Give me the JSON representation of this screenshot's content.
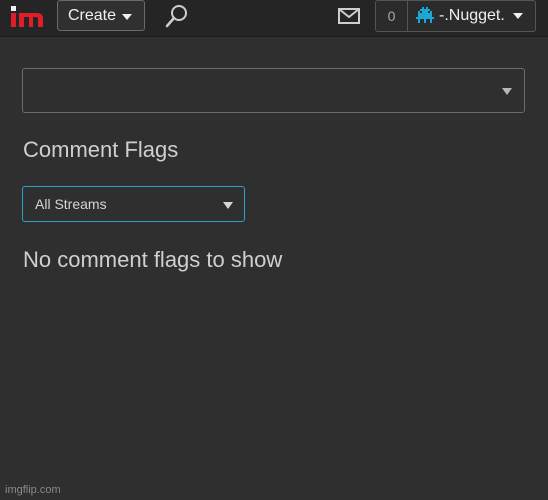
{
  "header": {
    "logo_letters": "im",
    "create_label": "Create",
    "notification_count": "0",
    "username": "-.Nugget.",
    "icons": {
      "search": "search-icon",
      "mail": "mail-icon",
      "caret": "chevron-down-icon",
      "avatar": "pixel-avatar-icon"
    }
  },
  "main": {
    "title": "Comment Flags",
    "stream_filter_value": "All Streams",
    "empty_message": "No comment flags to show"
  },
  "footer": {
    "watermark": "imgflip.com"
  },
  "colors": {
    "background": "#2f2f2f",
    "topbar": "#252525",
    "accent_focus": "#29a3c7",
    "logo_red": "#e01e2a",
    "avatar_blue": "#1aa7d6"
  }
}
